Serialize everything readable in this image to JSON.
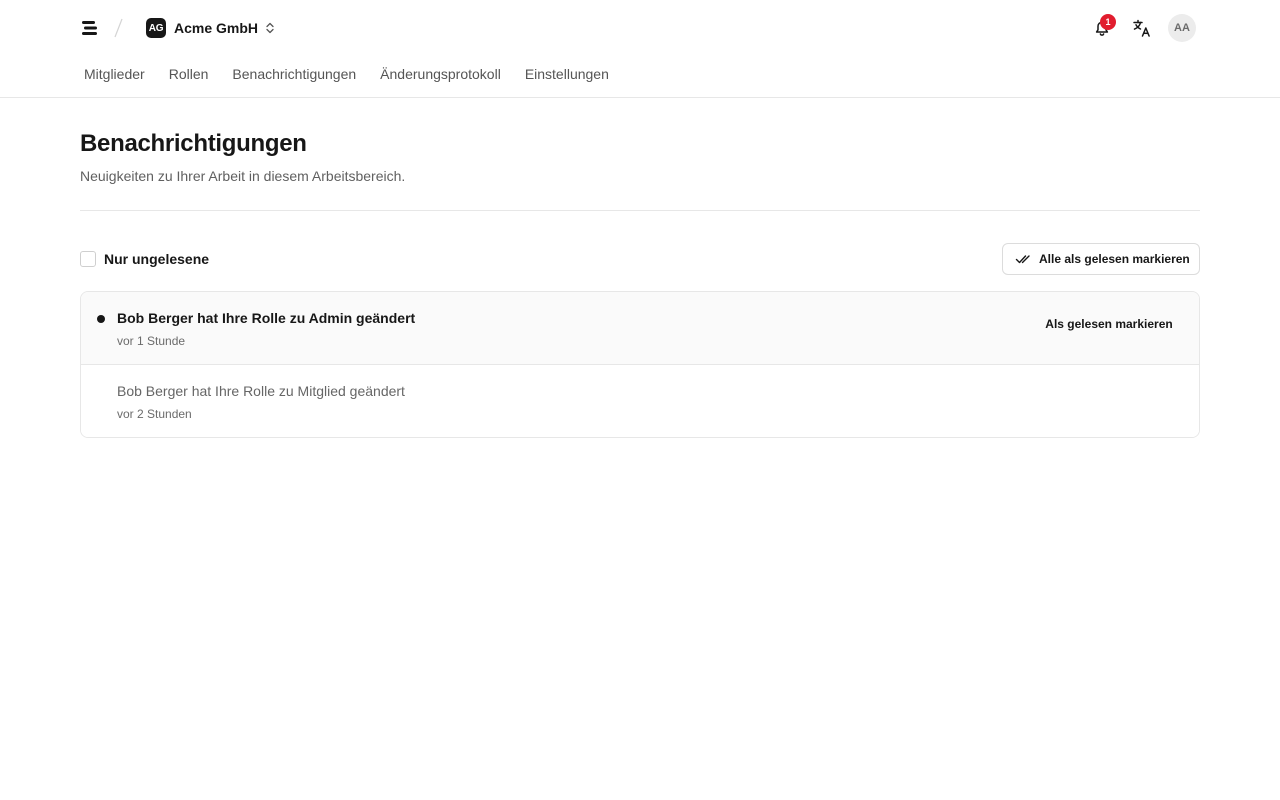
{
  "header": {
    "org_initials": "AG",
    "org_name": "Acme GmbH",
    "notification_count": "1",
    "user_initials": "AA"
  },
  "nav": {
    "tabs": [
      {
        "label": "Mitglieder"
      },
      {
        "label": "Rollen"
      },
      {
        "label": "Benachrichtigungen"
      },
      {
        "label": "Änderungsprotokoll"
      },
      {
        "label": "Einstellungen"
      }
    ]
  },
  "page": {
    "title": "Benachrichtigungen",
    "subtitle": "Neuigkeiten zu Ihrer Arbeit in diesem Arbeitsbereich."
  },
  "filters": {
    "unread_only_label": "Nur ungelesene",
    "mark_all_label": "Alle als gelesen markieren"
  },
  "notifications": [
    {
      "message": "Bob Berger hat Ihre Rolle zu Admin geändert",
      "time": "vor 1 Stunde",
      "action_label": "Als gelesen markieren",
      "unread": true
    },
    {
      "message": "Bob Berger hat Ihre Rolle zu Mitglied geändert",
      "time": "vor 2 Stunden",
      "unread": false
    }
  ],
  "colors": {
    "badge": "#e11d2e",
    "text": "#171717",
    "muted": "#606060",
    "border": "#e7e7e7"
  }
}
